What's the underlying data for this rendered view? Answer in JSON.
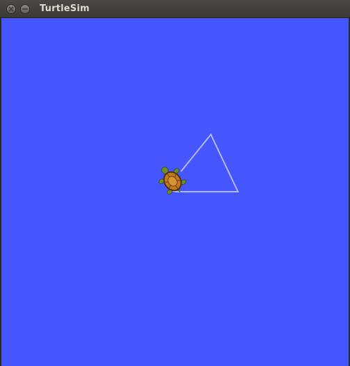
{
  "window": {
    "title": "TurtleSim",
    "close_icon": "close-icon",
    "minimize_icon": "minimize-icon"
  },
  "canvas": {
    "background_color": "#4556ff",
    "pen_color": "#b3b8ff",
    "turtle_icon": "turtle-icon"
  }
}
